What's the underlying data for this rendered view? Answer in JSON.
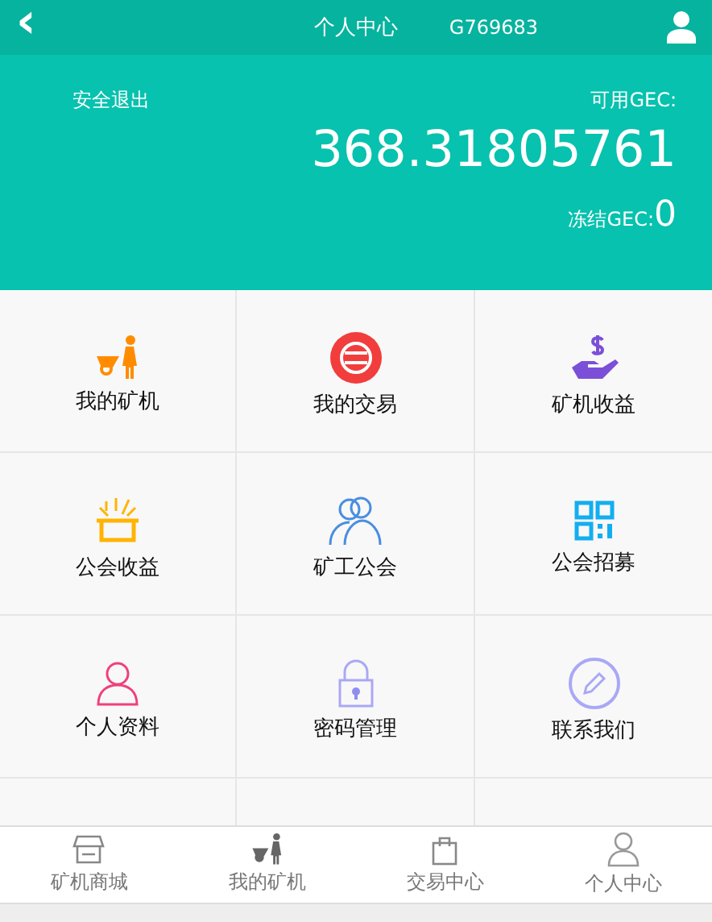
{
  "header": {
    "back": "‹",
    "title": "个人中心",
    "account": "G769683"
  },
  "balance": {
    "logout": "安全退出",
    "available_label": "可用GEC:",
    "available_value": "368.31805761",
    "frozen_label": "冻结GEC:",
    "frozen_value": "0"
  },
  "menu": [
    {
      "label": "我的矿机",
      "kind": "miner"
    },
    {
      "label": "我的交易",
      "kind": "trade"
    },
    {
      "label": "矿机收益",
      "kind": "income"
    },
    {
      "label": "公会收益",
      "kind": "gift"
    },
    {
      "label": "矿工公会",
      "kind": "group"
    },
    {
      "label": "公会招募",
      "kind": "qr"
    },
    {
      "label": "个人资料",
      "kind": "person"
    },
    {
      "label": "密码管理",
      "kind": "lock"
    },
    {
      "label": "联系我们",
      "kind": "pencil"
    }
  ],
  "tabbar": [
    {
      "label": "矿机商城",
      "kind": "shop"
    },
    {
      "label": "我的矿机",
      "kind": "miner"
    },
    {
      "label": "交易中心",
      "kind": "bag"
    },
    {
      "label": "个人中心",
      "kind": "person"
    }
  ]
}
